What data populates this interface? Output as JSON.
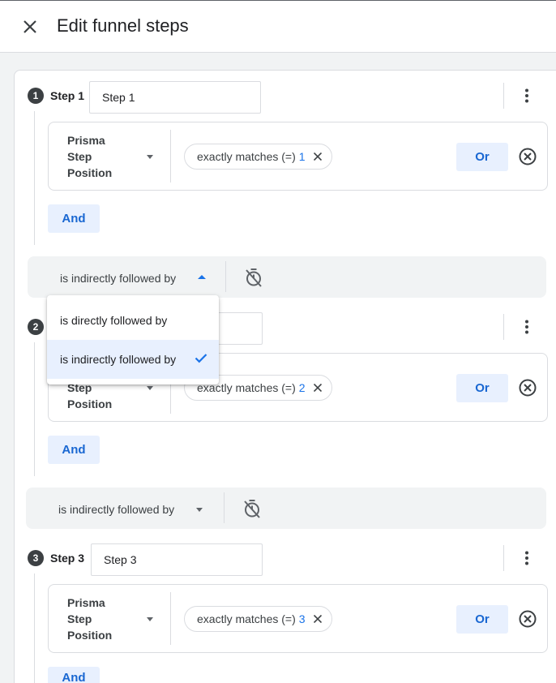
{
  "header": {
    "title": "Edit funnel steps",
    "close_icon": "close-icon"
  },
  "colors": {
    "accent": "#1a73e8",
    "button_bg": "#e8f0fe",
    "bar_bg": "#f1f3f4"
  },
  "steps": [
    {
      "number": "1",
      "label": "Step 1",
      "name_value": "Step 1",
      "dimension": "Prisma Step Position",
      "operator": "exactly matches (=)",
      "value": "1",
      "or_label": "Or",
      "and_label": "And"
    },
    {
      "number": "2",
      "label": "Step 2",
      "name_value": "",
      "dimension": "Prisma Step Position",
      "operator": "exactly matches (=)",
      "value": "2",
      "or_label": "Or",
      "and_label": "And"
    },
    {
      "number": "3",
      "label": "Step 3",
      "name_value": "Step 3",
      "dimension": "Prisma Step Position",
      "operator": "exactly matches (=)",
      "value": "3",
      "or_label": "Or",
      "and_label": "And"
    }
  ],
  "sequences": [
    {
      "value": "is indirectly followed by",
      "open": true,
      "timer_icon": "timer-off-icon"
    },
    {
      "value": "is indirectly followed by",
      "open": false,
      "timer_icon": "timer-off-icon"
    }
  ],
  "dropdown": {
    "options": [
      {
        "label": "is directly followed by",
        "selected": false
      },
      {
        "label": "is indirectly followed by",
        "selected": true
      }
    ]
  }
}
